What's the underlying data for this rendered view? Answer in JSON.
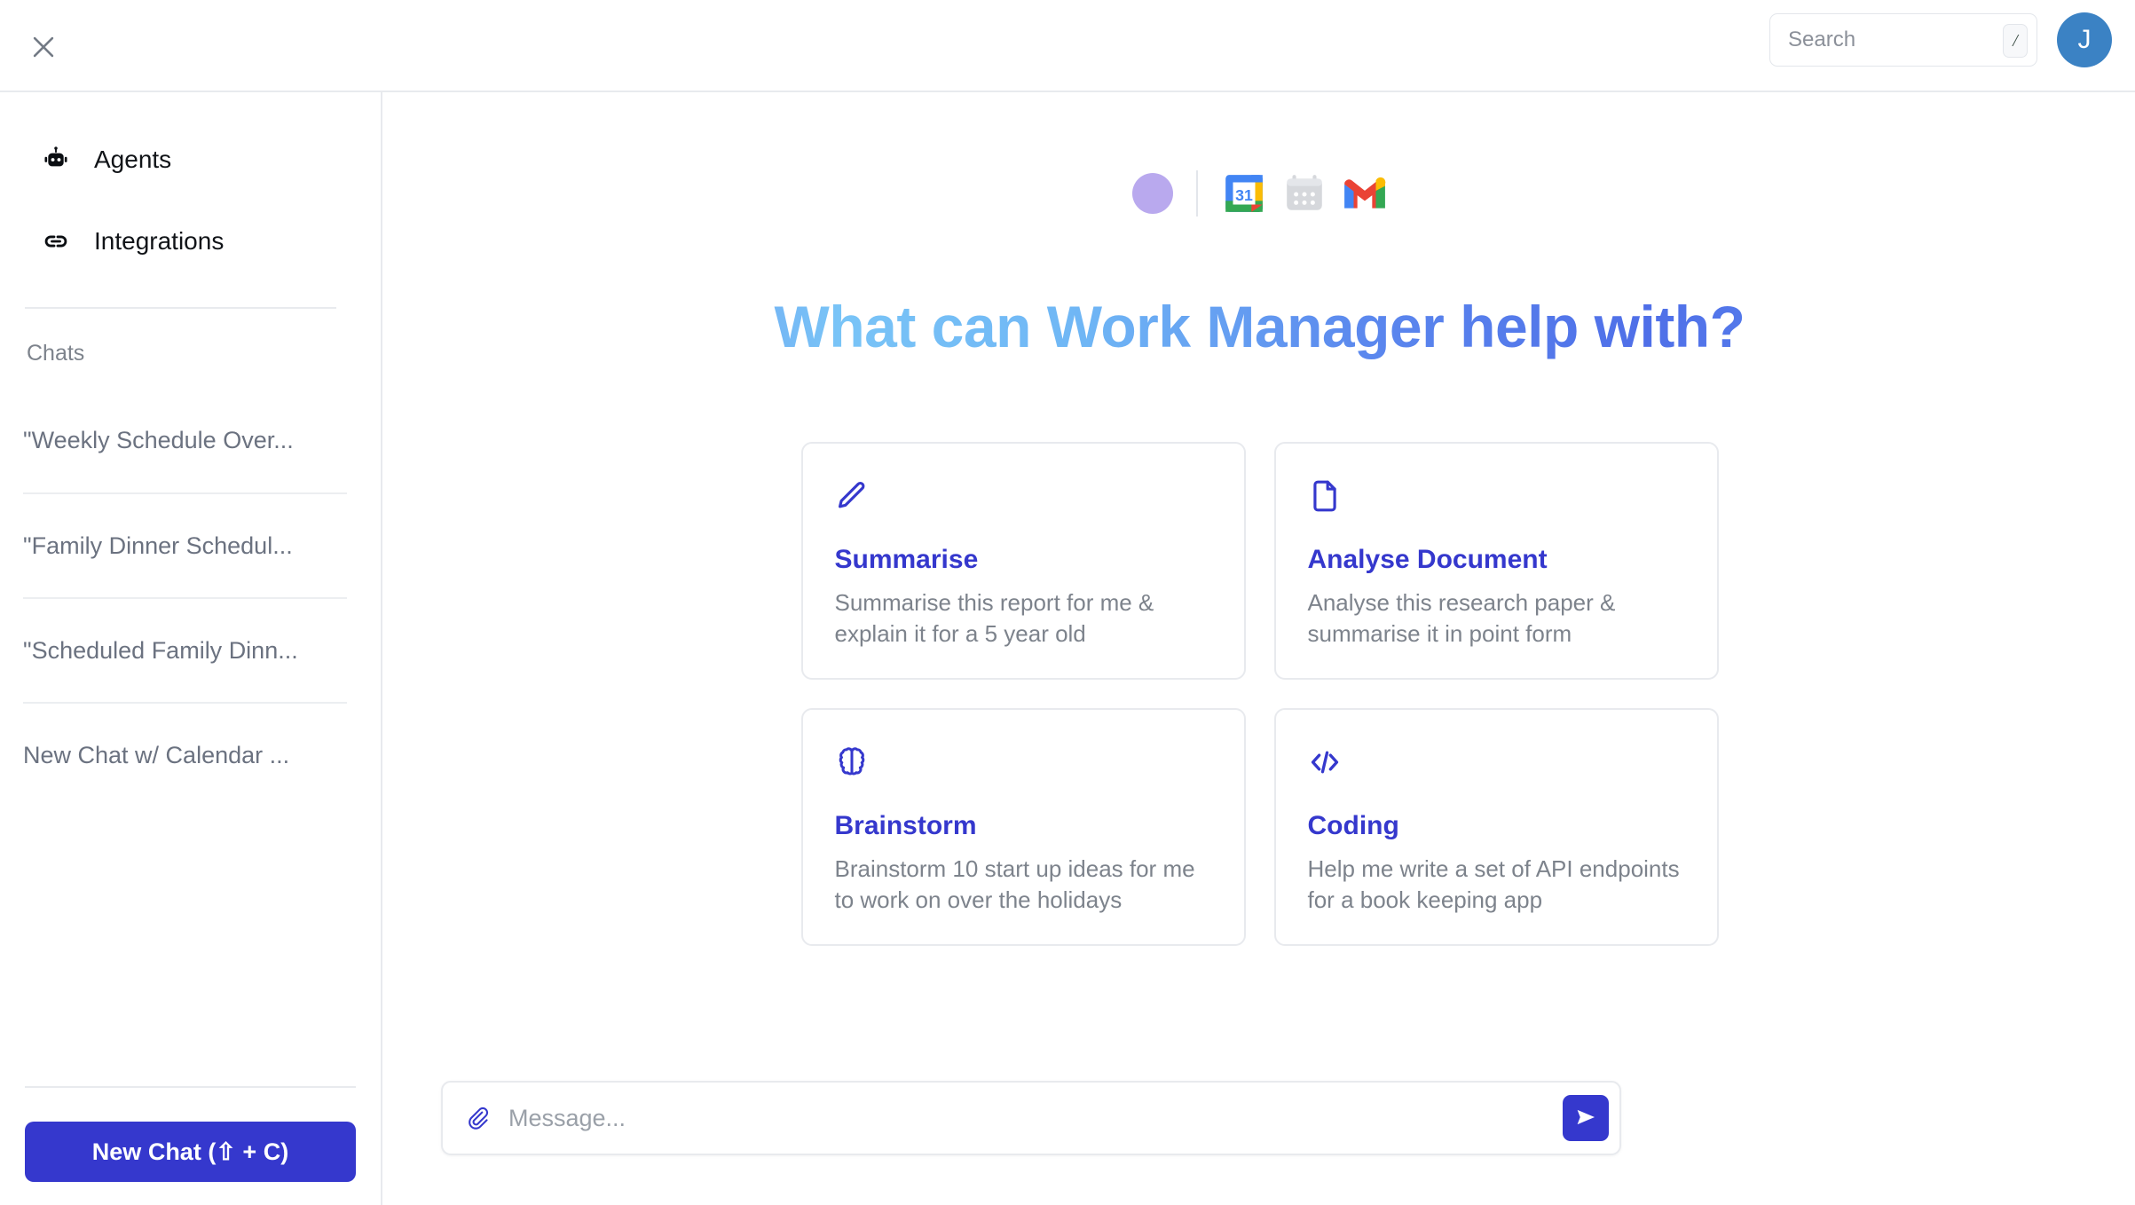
{
  "header": {
    "close_icon": "close-icon",
    "search": {
      "placeholder": "Search",
      "value": "",
      "shortcut_badge": "/"
    },
    "avatar_initial": "J"
  },
  "sidebar": {
    "nav_items": [
      {
        "label": "Agents",
        "icon": "robot-icon"
      },
      {
        "label": "Integrations",
        "icon": "link-icon"
      }
    ],
    "chats_heading": "Chats",
    "chats": [
      {
        "label": "\"Weekly Schedule Over..."
      },
      {
        "label": "\"Family Dinner Schedul..."
      },
      {
        "label": "\"Scheduled Family Dinn..."
      },
      {
        "label": "New Chat w/ Calendar ..."
      }
    ],
    "new_chat_button": "New Chat (⇧ + C)"
  },
  "main": {
    "integrations": [
      {
        "name": "status-dot",
        "icon": "purple-circle-icon"
      },
      {
        "name": "divider",
        "icon": "vertical-divider"
      },
      {
        "name": "google-calendar",
        "icon": "google-calendar-icon",
        "day": "31"
      },
      {
        "name": "calendar",
        "icon": "calendar-icon"
      },
      {
        "name": "gmail",
        "icon": "gmail-icon"
      }
    ],
    "hero_title": "What can Work Manager help with?",
    "cards": [
      {
        "icon": "pencil-icon",
        "title": "Summarise",
        "description": "Summarise this report for me & explain it for a 5 year old"
      },
      {
        "icon": "document-icon",
        "title": "Analyse Document",
        "description": "Analyse this research paper & summarise it in point form"
      },
      {
        "icon": "brain-icon",
        "title": "Brainstorm",
        "description": "Brainstorm 10 start up ideas for me to work on over the holidays"
      },
      {
        "icon": "code-icon",
        "title": "Coding",
        "description": "Help me write a set of API endpoints for a book keeping app"
      }
    ],
    "message_bar": {
      "attach_icon": "paperclip-icon",
      "placeholder": "Message...",
      "value": "",
      "send_icon": "send-icon"
    }
  },
  "colors": {
    "brand_indigo": "#3538cd",
    "avatar_blue": "#3b82c4",
    "purple_dot": "#b9a9ee",
    "border": "#e8eaee",
    "muted_text": "#7d838c"
  }
}
